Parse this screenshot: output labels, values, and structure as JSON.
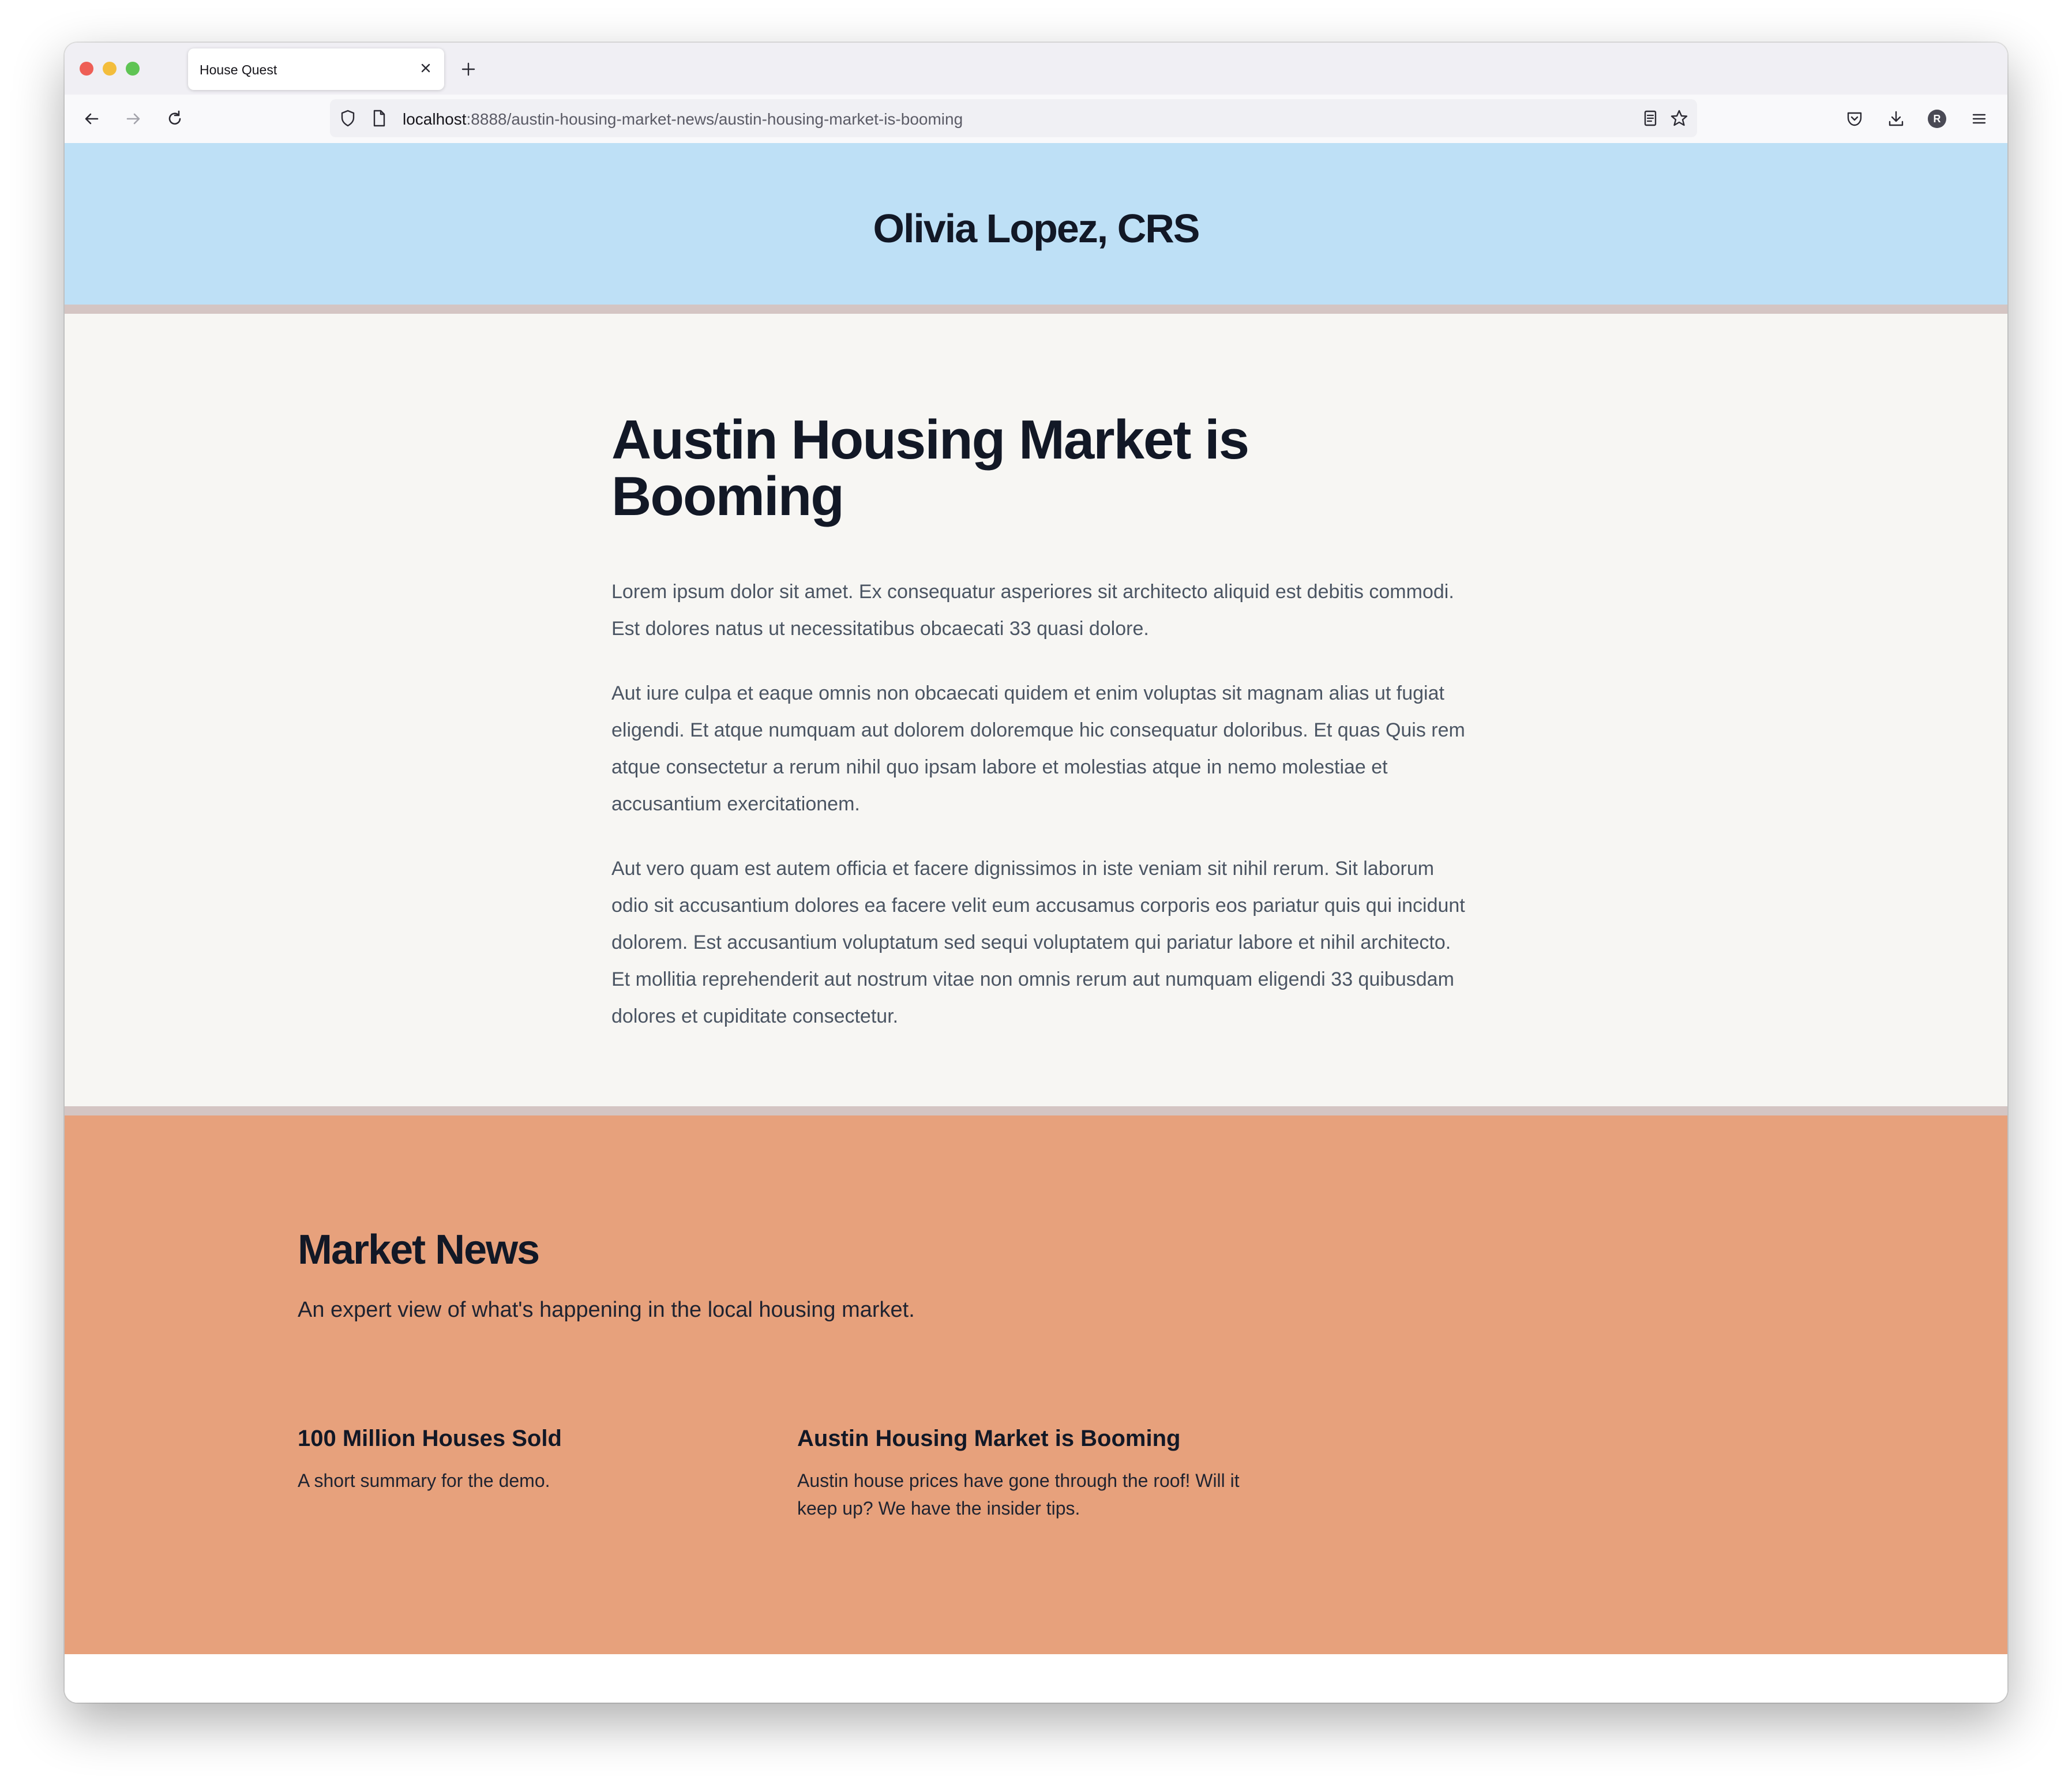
{
  "browser": {
    "tab_title": "House Quest",
    "url_host": "localhost",
    "url_rest": ":8888/austin-housing-market-news/austin-housing-market-is-booming",
    "profile_initial": "R"
  },
  "site": {
    "name": "Olivia Lopez, CRS"
  },
  "article": {
    "title": "Austin Housing Market is Booming",
    "paragraphs": [
      "Lorem ipsum dolor sit amet. Ex consequatur asperiores sit architecto aliquid est debitis commodi. Est dolores natus ut necessitatibus obcaecati 33 quasi dolore.",
      "Aut iure culpa et eaque omnis non obcaecati quidem et enim voluptas sit magnam alias ut fugiat eligendi. Et atque numquam aut dolorem doloremque hic consequatur doloribus. Et quas Quis rem atque consectetur a rerum nihil quo ipsam labore et molestias atque in nemo molestiae et accusantium exercitationem.",
      "Aut vero quam est autem officia et facere dignissimos in iste veniam sit nihil rerum. Sit laborum odio sit accusantium dolores ea facere velit eum accusamus corporis eos pariatur quis qui incidunt dolorem. Est accusantium voluptatum sed sequi voluptatem qui pariatur labore et nihil architecto. Et mollitia reprehenderit aut nostrum vitae non omnis rerum aut numquam eligendi 33 quibusdam dolores et cupiditate consectetur."
    ]
  },
  "market_news": {
    "title": "Market News",
    "subtitle": "An expert view of what's happening in the local housing market.",
    "items": [
      {
        "title": "100 Million Houses Sold",
        "summary": "A short summary for the demo."
      },
      {
        "title": "Austin Housing Market is Booming",
        "summary": "Austin house prices have gone through the roof! Will it keep up? We have the insider tips."
      }
    ]
  },
  "colors": {
    "header_bg": "#bee0f6",
    "article_bg": "#f7f6f3",
    "news_bg": "#e7a17c",
    "divider": "#d4c5c3",
    "heading": "#121826"
  }
}
